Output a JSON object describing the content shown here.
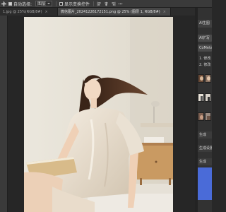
{
  "options_bar": {
    "auto_select_label": "自动选择:",
    "auto_select_target": "图层",
    "transform_controls_label": "显示变换控件"
  },
  "tabs": [
    {
      "label": "1.jpg @ 25%(RGB/8#)",
      "close": "×",
      "active": false
    },
    {
      "label": "微信图片_20241226172151.png @ 25% (图层 1, RGB/8#)",
      "close": "×",
      "active": true
    }
  ],
  "panel": {
    "title": "AI生图",
    "ai_expand_button": "AI扩写",
    "model_button": "CoMeta...",
    "step1": "1. 修改",
    "step2": "2. 修改",
    "generate_section": "生成",
    "generate_settings_section": "生成设置",
    "generate_section2": "生成"
  },
  "colors": {
    "app_bg": "#282828",
    "toolbar_bg": "#3a3a3a",
    "panel_bg": "#323232",
    "accent_blue": "#4a6bd8"
  }
}
